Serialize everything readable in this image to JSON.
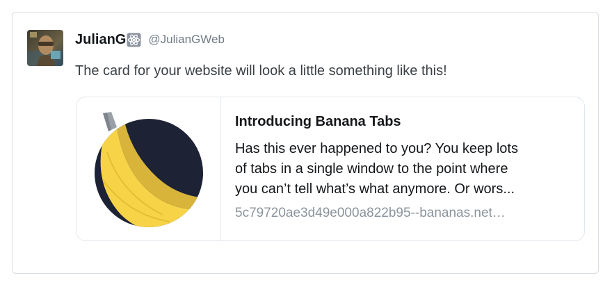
{
  "tweet": {
    "author": {
      "display_name": "JulianG",
      "name_emoji": "atom-emoji-icon",
      "handle": "@JulianGWeb"
    },
    "text": "The card for your website will look a little something like this!"
  },
  "card": {
    "image_icon": "banana-logo-icon",
    "title": "Introducing Banana Tabs",
    "description_lines": [
      "Has this ever happened to you? You keep lots",
      "of tabs in a single window to the point where",
      "you can’t tell what’s what anymore. Or wors..."
    ],
    "url": "5c79720ae3d49e000a822b95--bananas.net…"
  },
  "colors": {
    "border": "#d8dde2",
    "banana_yellow": "#f7d348",
    "circle_navy": "#1d2234",
    "muted_text": "#8b949c"
  }
}
